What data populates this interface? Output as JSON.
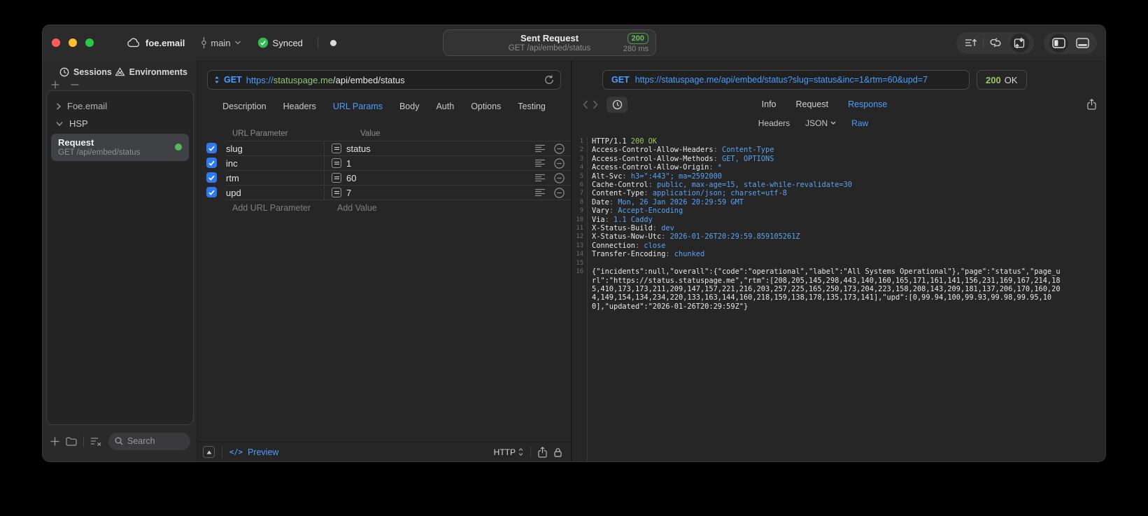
{
  "titlebar": {
    "project": "foe.email",
    "branch": "main",
    "sync": "Synced",
    "center": {
      "title": "Sent Request",
      "status": "200",
      "subtitle": "GET /api/embed/status",
      "time": "280 ms"
    }
  },
  "sidebar": {
    "tabs": [
      {
        "label": "Sessions"
      },
      {
        "label": "Environments"
      }
    ],
    "tree": [
      {
        "label": "Foe.email",
        "state": "collapsed"
      },
      {
        "label": "HSP",
        "state": "expanded"
      }
    ],
    "request_item": {
      "title": "Request",
      "subtitle": "GET /api/embed/status"
    },
    "search_placeholder": "Search"
  },
  "request": {
    "method": "GET",
    "url": {
      "scheme": "https://",
      "host": "statuspage.me",
      "path": "/api/embed/status"
    },
    "tabs": [
      "Description",
      "Headers",
      "URL Params",
      "Body",
      "Auth",
      "Options",
      "Testing"
    ],
    "active_tab": "URL Params",
    "params": {
      "col_param": "URL Parameter",
      "col_value": "Value",
      "rows": [
        {
          "name": "slug",
          "value": "status",
          "enabled": true
        },
        {
          "name": "inc",
          "value": "1",
          "enabled": true
        },
        {
          "name": "rtm",
          "value": "60",
          "enabled": true
        },
        {
          "name": "upd",
          "value": "7",
          "enabled": true
        }
      ],
      "add_name": "Add URL Parameter",
      "add_value": "Add Value"
    },
    "footer": {
      "code_glyph": "</>",
      "preview": "Preview",
      "protocol": "HTTP"
    }
  },
  "response": {
    "method": "GET",
    "url": "https://statuspage.me/api/embed/status?slug=status&inc=1&rtm=60&upd=7",
    "status_code": "200",
    "status_text": "OK",
    "tabs": [
      "Info",
      "Request",
      "Response"
    ],
    "active_tab": "Response",
    "subtabs": [
      "Headers",
      "JSON",
      "Raw"
    ],
    "active_subtab": "Raw",
    "body_lines": [
      {
        "n": 1,
        "parts": [
          {
            "t": "HTTP/1.1 ",
            "c": "w"
          },
          {
            "t": "200 OK",
            "c": "g"
          }
        ]
      },
      {
        "n": 2,
        "parts": [
          {
            "t": "Access-Control-Allow-Headers",
            "c": "w"
          },
          {
            "t": ": ",
            "c": "d"
          },
          {
            "t": "Content-Type",
            "c": "b"
          }
        ]
      },
      {
        "n": 3,
        "parts": [
          {
            "t": "Access-Control-Allow-Methods",
            "c": "w"
          },
          {
            "t": ": ",
            "c": "d"
          },
          {
            "t": "GET, OPTIONS",
            "c": "b"
          }
        ]
      },
      {
        "n": 4,
        "parts": [
          {
            "t": "Access-Control-Allow-Origin",
            "c": "w"
          },
          {
            "t": ": ",
            "c": "d"
          },
          {
            "t": "*",
            "c": "b"
          }
        ]
      },
      {
        "n": 5,
        "parts": [
          {
            "t": "Alt-Svc",
            "c": "w"
          },
          {
            "t": ": ",
            "c": "d"
          },
          {
            "t": "h3=\":443\"; ma=2592000",
            "c": "b"
          }
        ]
      },
      {
        "n": 6,
        "parts": [
          {
            "t": "Cache-Control",
            "c": "w"
          },
          {
            "t": ": ",
            "c": "d"
          },
          {
            "t": "public, max-age=15, stale-while-revalidate=30",
            "c": "b"
          }
        ]
      },
      {
        "n": 7,
        "parts": [
          {
            "t": "Content-Type",
            "c": "w"
          },
          {
            "t": ": ",
            "c": "d"
          },
          {
            "t": "application/json; charset=utf-8",
            "c": "b"
          }
        ]
      },
      {
        "n": 8,
        "parts": [
          {
            "t": "Date",
            "c": "w"
          },
          {
            "t": ": ",
            "c": "d"
          },
          {
            "t": "Mon, 26 Jan 2026 20:29:59 GMT",
            "c": "b"
          }
        ]
      },
      {
        "n": 9,
        "parts": [
          {
            "t": "Vary",
            "c": "w"
          },
          {
            "t": ": ",
            "c": "d"
          },
          {
            "t": "Accept-Encoding",
            "c": "b"
          }
        ]
      },
      {
        "n": 10,
        "parts": [
          {
            "t": "Via",
            "c": "w"
          },
          {
            "t": ": ",
            "c": "d"
          },
          {
            "t": "1.1 Caddy",
            "c": "b"
          }
        ]
      },
      {
        "n": 11,
        "parts": [
          {
            "t": "X-Status-Build",
            "c": "w"
          },
          {
            "t": ": ",
            "c": "d"
          },
          {
            "t": "dev",
            "c": "b"
          }
        ]
      },
      {
        "n": 12,
        "parts": [
          {
            "t": "X-Status-Now-Utc",
            "c": "w"
          },
          {
            "t": ": ",
            "c": "d"
          },
          {
            "t": "2026-01-26T20:29:59.859105261Z",
            "c": "b"
          }
        ]
      },
      {
        "n": 13,
        "parts": [
          {
            "t": "Connection",
            "c": "w"
          },
          {
            "t": ": ",
            "c": "d"
          },
          {
            "t": "close",
            "c": "b"
          }
        ]
      },
      {
        "n": 14,
        "parts": [
          {
            "t": "Transfer-Encoding",
            "c": "w"
          },
          {
            "t": ": ",
            "c": "d"
          },
          {
            "t": "chunked",
            "c": "b"
          }
        ]
      },
      {
        "n": 15,
        "parts": []
      },
      {
        "n": 16,
        "parts": [
          {
            "t": "{\"incidents\":null,\"overall\":{\"code\":\"operational\",\"label\":\"All Systems Operational\"},\"page\":\"status\",\"page_url\":\"https://status.statuspage.me\",\"rtm\":[208,205,145,298,443,140,160,165,171,161,141,156,231,169,167,214,185,410,173,173,211,209,147,157,221,216,203,257,225,165,250,173,204,223,158,208,143,209,181,137,206,170,160,204,149,154,134,234,220,133,163,144,160,218,159,138,178,135,173,141],\"upd\":[0,99.94,100,99.93,99.98,99.95,100],\"updated\":\"2026-01-26T20:29:59Z\"}",
            "c": "w"
          }
        ]
      }
    ]
  },
  "colors": {
    "accent_blue": "#4a9eff",
    "url_host_green": "#8cc872",
    "status_green": "#5fc45f",
    "checkbox_blue": "#3078f0"
  }
}
